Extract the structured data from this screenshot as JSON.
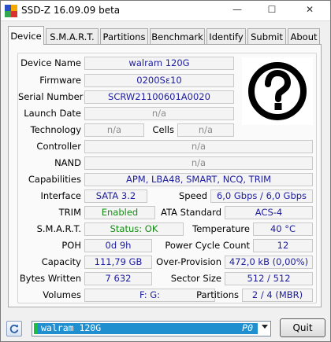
{
  "window": {
    "title": "SSD-Z 16.09.09 beta",
    "controls": {
      "min": "—",
      "max": "☐",
      "close": "✕"
    }
  },
  "tabs": [
    "Device",
    "S.M.A.R.T.",
    "Partitions",
    "Benchmark",
    "Identify",
    "Submit",
    "About"
  ],
  "active_tab": "Device",
  "device": {
    "labels": {
      "device_name": "Device Name",
      "firmware": "Firmware",
      "serial_number": "Serial Number",
      "launch_date": "Launch Date",
      "technology": "Technology",
      "cells": "Cells",
      "controller": "Controller",
      "nand": "NAND",
      "capabilities": "Capabilities",
      "interface": "Interface",
      "speed": "Speed",
      "trim": "TRIM",
      "ata_standard": "ATA Standard",
      "smart": "S.M.A.R.T.",
      "temperature": "Temperature",
      "poh": "POH",
      "power_cycle_count": "Power Cycle Count",
      "capacity": "Capacity",
      "over_provision": "Over-Provision",
      "bytes_written": "Bytes Written",
      "sector_size": "Sector Size",
      "volumes": "Volumes",
      "partitions": "Partitions"
    },
    "values": {
      "device_name": "walram 120G",
      "firmware": "0200Sε10",
      "serial_number": "SCRW21100601A0020",
      "launch_date": "n/a",
      "technology": "n/a",
      "cells": "n/a",
      "controller": "n/a",
      "nand": "n/a",
      "capabilities": "APM, LBA48, SMART, NCQ, TRIM",
      "interface": "SATA 3.2",
      "speed": "6,0 Gbps / 6,0 Gbps",
      "trim": "Enabled",
      "ata_standard": "ACS-4",
      "smart": "Status: OK",
      "temperature": "40 °C",
      "poh": "0d 9h",
      "power_cycle_count": "12",
      "capacity": "111,79 GB",
      "over_provision": "472,0 kB (0,00%)",
      "bytes_written": "7 632",
      "sector_size": "512 / 512",
      "volumes": "F:  G:",
      "partitions": "2 / 4 (MBR)"
    },
    "logo_icon": "question-mark-icon"
  },
  "bottom": {
    "selected_device": "walram 120G",
    "selected_slot": "P0",
    "quit_label": "Quit",
    "refresh_icon": "refresh-icon"
  },
  "colors": {
    "value_blue": "#1d1da0",
    "value_green": "#148c14",
    "value_gray": "#8c8c8c",
    "selector_blue": "#1f8fd0",
    "selector_stripe": "#1dbd42"
  }
}
